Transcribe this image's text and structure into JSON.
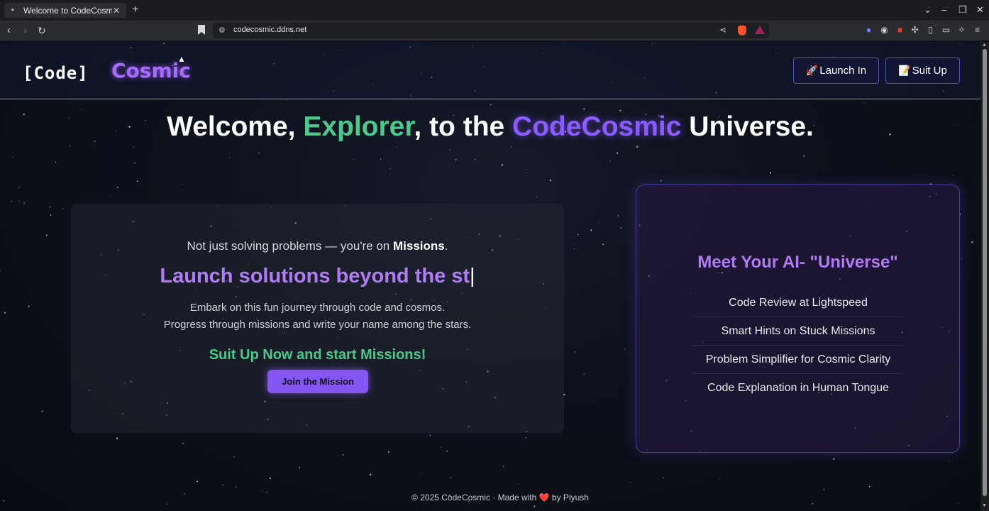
{
  "browser": {
    "tab_title": "Welcome to CodeCosmic",
    "tab_close": "✕",
    "new_tab": "+",
    "url": "codecosmic.ddns.net"
  },
  "header": {
    "logo_code": "[Code]",
    "logo_cosmic": "Cosmic",
    "launch_emoji": "🚀",
    "launch_label": "Launch In",
    "suit_emoji": "📝",
    "suit_label": "Suit Up"
  },
  "hero": {
    "part1": "Welcome, ",
    "highlight1": "Explorer",
    "part2": ", to the ",
    "highlight2": "CodeCosmic",
    "part3": " Universe."
  },
  "mission": {
    "intro_prefix": "Not just solving problems — you're on ",
    "intro_bold": "Missions",
    "intro_suffix": ".",
    "typing_text": "Launch solutions beyond the st",
    "caret": "|",
    "desc_line1": "Embark on this fun journey through code and cosmos.",
    "desc_line2": "Progress through missions and write your name among the stars.",
    "cta": "Suit Up Now and start Missions!",
    "join_button": "Join the Mission"
  },
  "ai_card": {
    "title": "Meet Your AI- \"Universe\"",
    "features": [
      "Code Review at Lightspeed",
      "Smart Hints on Stuck Missions",
      "Problem Simplifier for Cosmic Clarity",
      "Code Explanation in Human Tongue"
    ]
  },
  "footer": {
    "prefix": "© 2025 CodeCosmic · Made with ",
    "heart": "❤️",
    "suffix": " by Piyush"
  },
  "colors": {
    "accent_green": "#4bc98b",
    "accent_purple": "#8a5cff",
    "button_purple": "#8457f0",
    "card_border": "#4b3e95"
  }
}
